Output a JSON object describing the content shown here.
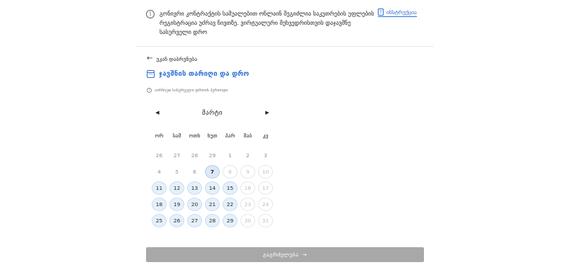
{
  "info": {
    "icon": "info-icon",
    "text": "გონივრი კონტრაქტის საშუალებით ონლაინ შეგიძლია საკუთრების უფლების რეგისტრაცია უძრავ ნივთზე. ვირტუალური შეხვედრისთვის დაჯავშნე სასურველი დრო",
    "instruction_link": "ინსტრუქცია"
  },
  "back": {
    "label": "უკან დაბრუნება"
  },
  "section": {
    "title": "ჯავშნის თარიღი და დრო"
  },
  "hint": {
    "text": "აირჩიეთ სასურველი დროის პერიოდი"
  },
  "calendar": {
    "month": "მარტი",
    "weekdays": [
      "ორ",
      "სამ",
      "ოთხ",
      "ხუთ",
      "პარ",
      "შაბ",
      "კვ"
    ],
    "days": [
      {
        "label": "26",
        "state": "prev"
      },
      {
        "label": "27",
        "state": "prev"
      },
      {
        "label": "28",
        "state": "prev"
      },
      {
        "label": "29",
        "state": "prev"
      },
      {
        "label": "1",
        "state": "past"
      },
      {
        "label": "2",
        "state": "past"
      },
      {
        "label": "3",
        "state": "past"
      },
      {
        "label": "4",
        "state": "past"
      },
      {
        "label": "5",
        "state": "past"
      },
      {
        "label": "6",
        "state": "past"
      },
      {
        "label": "7",
        "state": "today"
      },
      {
        "label": "8",
        "state": "dis"
      },
      {
        "label": "9",
        "state": "dis"
      },
      {
        "label": "10",
        "state": "dis"
      },
      {
        "label": "11",
        "state": "avail"
      },
      {
        "label": "12",
        "state": "avail"
      },
      {
        "label": "13",
        "state": "avail"
      },
      {
        "label": "14",
        "state": "avail"
      },
      {
        "label": "15",
        "state": "avail"
      },
      {
        "label": "16",
        "state": "dis"
      },
      {
        "label": "17",
        "state": "dis"
      },
      {
        "label": "18",
        "state": "avail"
      },
      {
        "label": "19",
        "state": "avail"
      },
      {
        "label": "20",
        "state": "avail"
      },
      {
        "label": "21",
        "state": "avail"
      },
      {
        "label": "22",
        "state": "avail"
      },
      {
        "label": "23",
        "state": "dis"
      },
      {
        "label": "24",
        "state": "dis"
      },
      {
        "label": "25",
        "state": "avail"
      },
      {
        "label": "26",
        "state": "avail"
      },
      {
        "label": "27",
        "state": "avail"
      },
      {
        "label": "28",
        "state": "avail"
      },
      {
        "label": "29",
        "state": "avail"
      },
      {
        "label": "30",
        "state": "dis"
      },
      {
        "label": "31",
        "state": "dis"
      }
    ]
  },
  "continue": {
    "label": "გაგრძელება",
    "arrow": "→"
  },
  "colors": {
    "accent": "#2f6fd6",
    "available_bg": "#e6f0fb",
    "button_disabled": "#a8a8a8"
  }
}
